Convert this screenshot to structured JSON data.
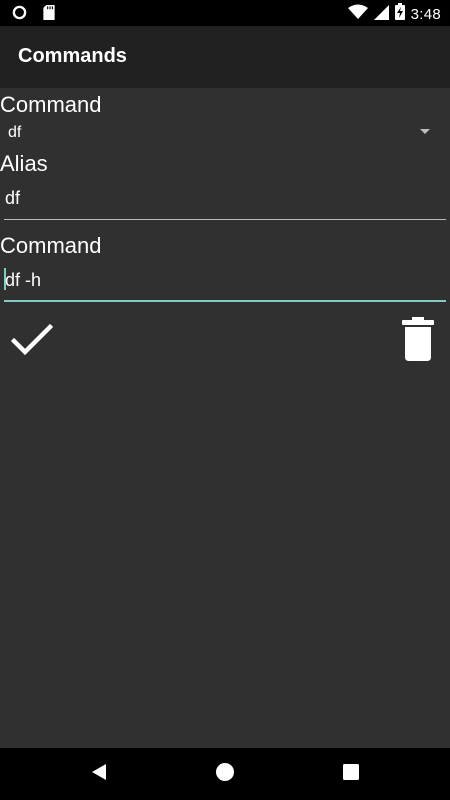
{
  "status_bar": {
    "time": "3:48",
    "icons": [
      "notification-dot-icon",
      "sd-card-icon",
      "wifi-icon",
      "signal-icon",
      "battery-charging-icon"
    ]
  },
  "app_bar": {
    "title": "Commands"
  },
  "form": {
    "command_spinner_label": "Command",
    "command_spinner_value": "df",
    "alias_label": "Alias",
    "alias_value": "df",
    "command_label": "Command",
    "command_value": "df -h"
  },
  "actions": {
    "confirm_icon": "check-icon",
    "delete_icon": "trash-icon"
  },
  "nav_bar": {
    "icons": [
      "back-icon",
      "home-icon",
      "recents-icon"
    ]
  },
  "colors": {
    "background": "#303030",
    "app_bar": "#212121",
    "accent": "#80cbc4"
  }
}
